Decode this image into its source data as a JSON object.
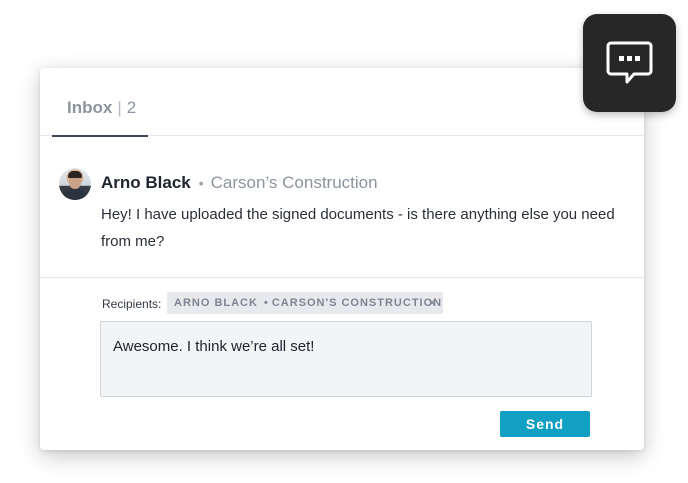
{
  "tabs": {
    "inbox_label": "Inbox",
    "separator": "|",
    "inbox_count": "2"
  },
  "message": {
    "sender_name": "Arno Black",
    "separator_dot": "•",
    "sender_company": "Carson’s Construction",
    "body": "Hey! I have uploaded the signed documents - is there anything else you need from me?"
  },
  "composer": {
    "recipients_label": "Recipients:",
    "recipient": {
      "name": "ARNO BLACK",
      "dot": "•",
      "company": "CARSON'S CONSTRUCTION",
      "remove_glyph": "✕"
    },
    "reply_value": "Awesome. I think we’re all set!",
    "send_label": "Send"
  },
  "icons": {
    "chat_fab": "chat-bubble-ellipsis-icon",
    "chip_remove": "close-icon",
    "avatar": "avatar"
  },
  "colors": {
    "send_button": "#119fc4",
    "chat_fab_bg": "#272727",
    "tab_underline": "#3a4656"
  }
}
